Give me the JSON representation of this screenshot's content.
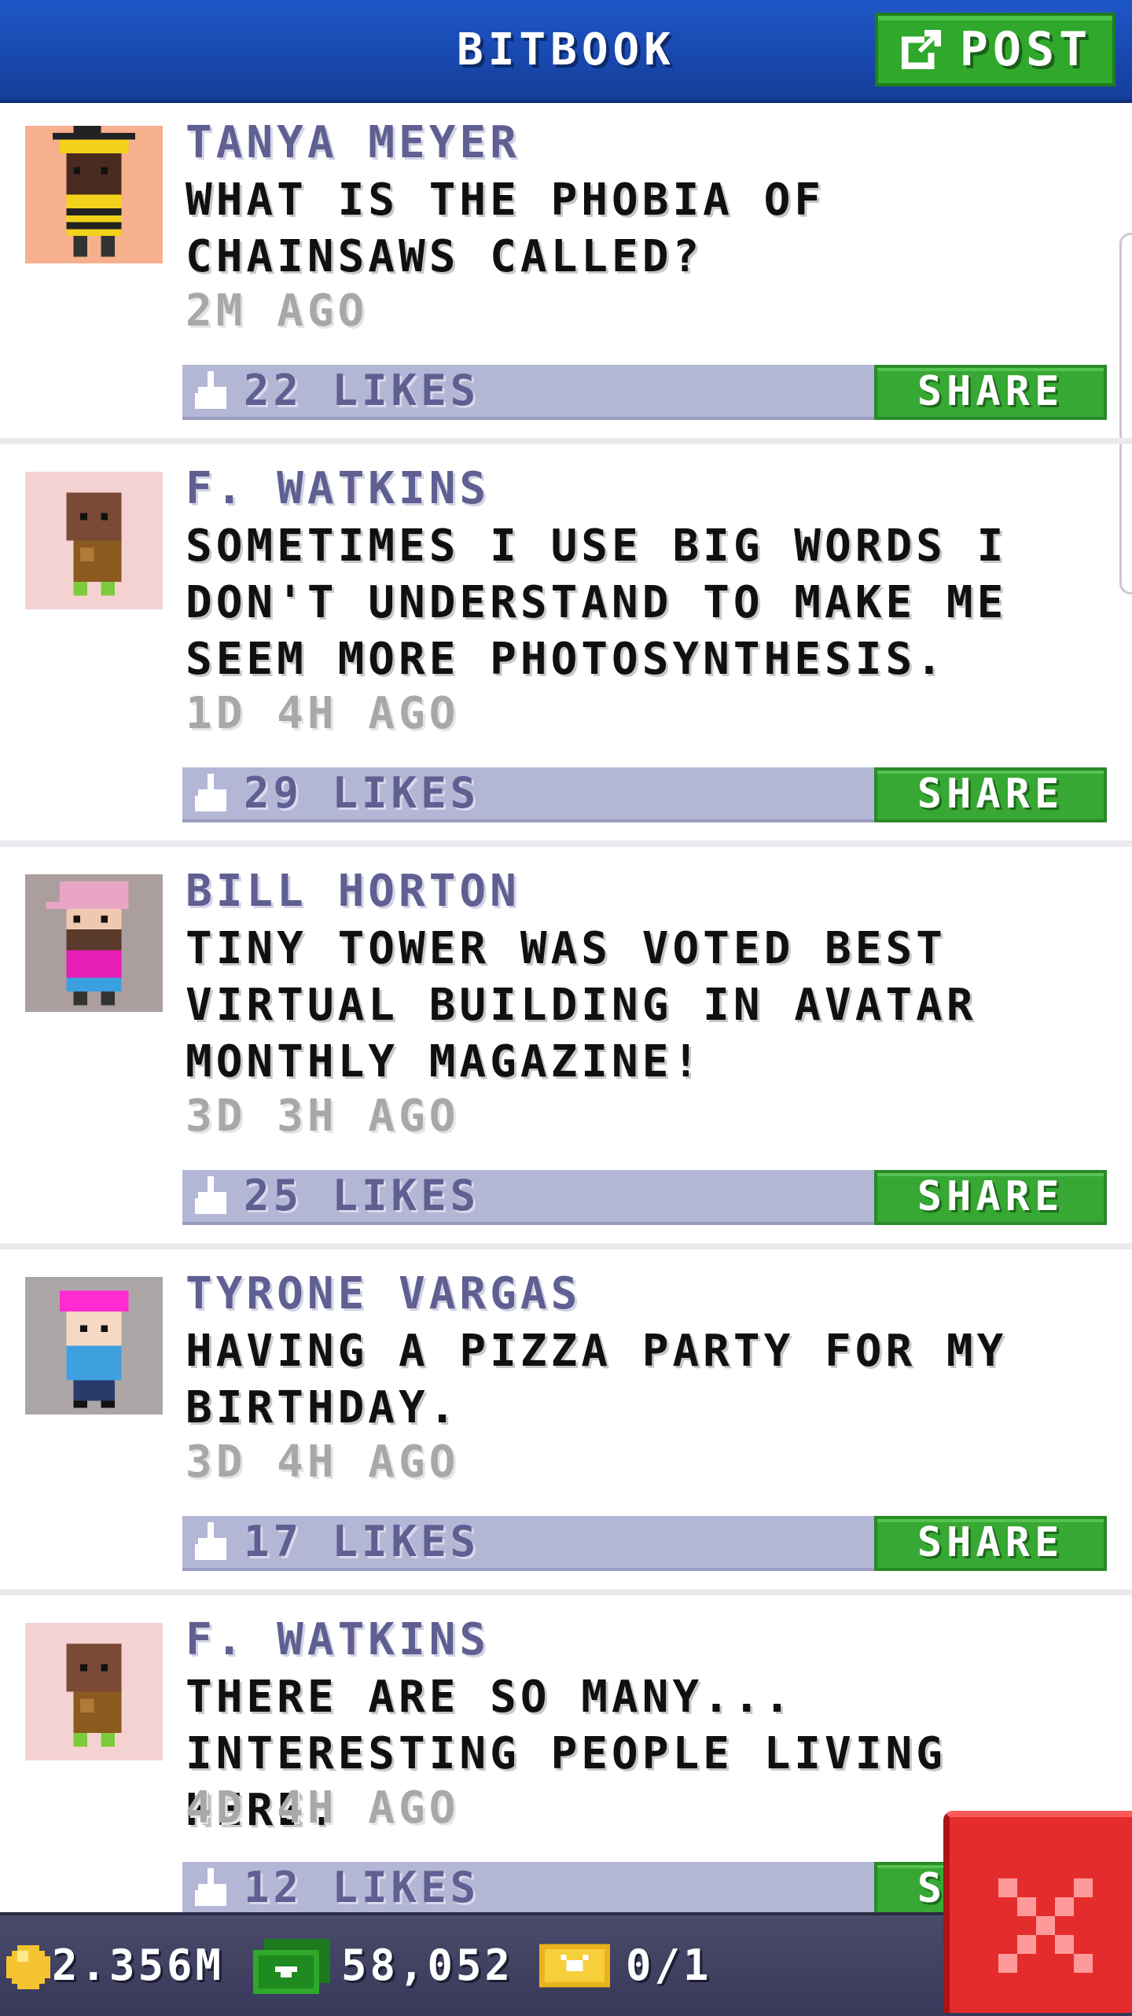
{
  "header": {
    "title": "BITBOOK",
    "post_label": "POST"
  },
  "posts": [
    {
      "name": "TANYA MEYER",
      "text": "WHAT IS THE PHOBIA OF CHAINSAWS CALLED?",
      "time": "2M AGO",
      "likes": "22 LIKES",
      "share_label": "SHARE",
      "avatar_bg": "#f7b08d"
    },
    {
      "name": "F. WATKINS",
      "text": "SOMETIMES I USE BIG WORDS I DON'T UNDERSTAND TO MAKE ME SEEM MORE PHOTOSYNTHESIS.",
      "time": "1D 4H AGO",
      "likes": "29 LIKES",
      "share_label": "SHARE",
      "avatar_bg": "#f5d2d2"
    },
    {
      "name": "BILL HORTON",
      "text": "TINY TOWER WAS VOTED BEST VIRTUAL BUILDING IN AVATAR MONTHLY MAGAZINE!",
      "time": "3D 3H AGO",
      "likes": "25 LIKES",
      "share_label": "SHARE",
      "avatar_bg": "#ab9e9e"
    },
    {
      "name": "TYRONE VARGAS",
      "text": "HAVING A PIZZA PARTY FOR MY BIRTHDAY.",
      "time": "3D 4H AGO",
      "likes": "17 LIKES",
      "share_label": "SHARE",
      "avatar_bg": "#aca7a6"
    },
    {
      "name": "F. WATKINS",
      "text": "THERE ARE SO MANY... INTERESTING PEOPLE LIVING HERE.",
      "time": "4D 4H AGO",
      "likes": "12 LIKES",
      "share_label": "SHARE",
      "avatar_bg": "#f5d2d2"
    }
  ],
  "status_bar": {
    "coins": "2.356M",
    "bux": "58,052",
    "tickets": "0/1"
  },
  "colors": {
    "header_blue": "#1d50bd",
    "share_green": "#36a833",
    "like_bar": "#b4b6d6",
    "name_purple": "#5f5f92",
    "close_red": "#e52c2c"
  }
}
